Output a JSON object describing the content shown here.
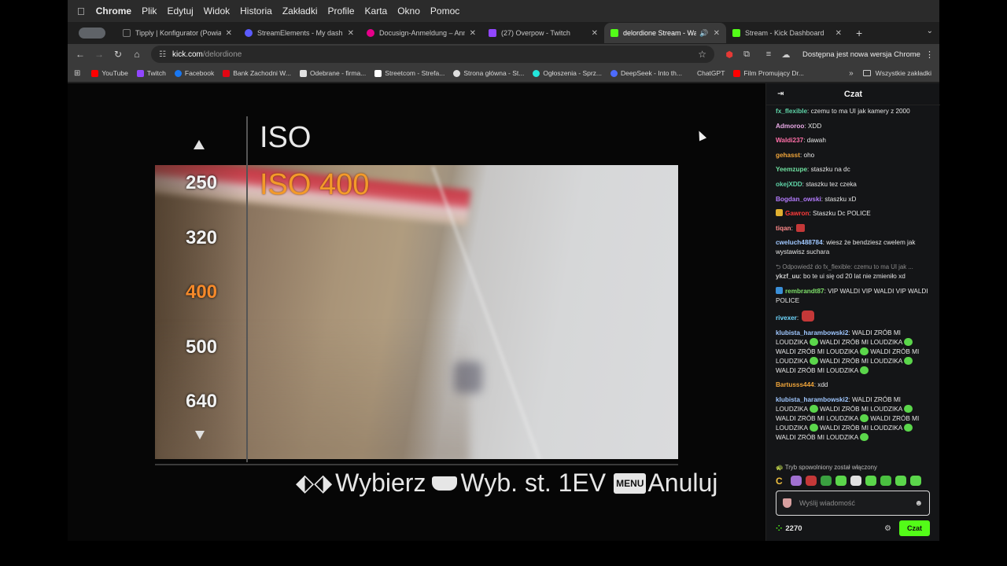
{
  "menubar": {
    "app": "Chrome",
    "items": [
      "Plik",
      "Edytuj",
      "Widok",
      "Historia",
      "Zakładki",
      "Profile",
      "Karta",
      "Okno",
      "Pomoc"
    ]
  },
  "tabs": [
    {
      "title": "Tipply | Konfigurator (Powiad",
      "color": "#222222"
    },
    {
      "title": "StreamElements - My dashb",
      "color": "#5b5bff"
    },
    {
      "title": "Docusign-Anmeldung – Anm",
      "color": "#e6008a"
    },
    {
      "title": "(27) Overpow - Twitch",
      "color": "#9146ff"
    },
    {
      "title": "delordione Stream - Watc",
      "color": "#53fc18",
      "active": true
    },
    {
      "title": "Stream - Kick Dashboard",
      "color": "#53fc18"
    }
  ],
  "toolbar": {
    "url_host": "kick.com",
    "url_path": "/delordione",
    "update_label": "Dostępna jest nowa wersja Chrome"
  },
  "bookmarks": [
    {
      "label": "YouTube",
      "color": "#ff0000"
    },
    {
      "label": "Twitch",
      "color": "#9146ff"
    },
    {
      "label": "Facebook",
      "color": "#1877f2"
    },
    {
      "label": "Bank Zachodni W...",
      "color": "#e30613"
    },
    {
      "label": "Odebrane - firma...",
      "color": "#e0e0e0"
    },
    {
      "label": "Streetcom - Strefa...",
      "color": "#ffffff"
    },
    {
      "label": "Strona główna - St...",
      "color": "#dddddd"
    },
    {
      "label": "Ogłoszenia - Sprz...",
      "color": "#23e5db"
    },
    {
      "label": "DeepSeek - Into th...",
      "color": "#4d6bfe"
    },
    {
      "label": "ChatGPT",
      "color": "#cccccc"
    },
    {
      "label": "Film Promujący Dr...",
      "color": "#ff0000"
    }
  ],
  "bookmarks_all": "Wszystkie zakładki",
  "camera": {
    "title": "ISO",
    "current": "ISO 400",
    "values": [
      "250",
      "320",
      "400",
      "500",
      "640"
    ],
    "selected_index": 2,
    "hint_select": "Wybierz",
    "hint_step": "Wyb. st. 1EV",
    "hint_menu_key": "MENU",
    "hint_cancel": "Anuluj"
  },
  "chat": {
    "title": "Czat",
    "messages": [
      {
        "user": "fx_flexible",
        "color": "#5fd4a8",
        "text": "czemu to ma UI jak kamery z 2000"
      },
      {
        "user": "Admoroo",
        "color": "#e8a9e6",
        "text": "XDD"
      },
      {
        "user": "Waldi237",
        "color": "#ff6fa8",
        "text": "dawah"
      },
      {
        "user": "gehasst",
        "color": "#f0a53a",
        "text": "oho"
      },
      {
        "user": "Yeemzupe",
        "color": "#6fe0a0",
        "text": "staszku na dc"
      },
      {
        "user": "okejXDD",
        "color": "#5fd4a8",
        "text": "staszku tez czeka"
      },
      {
        "user": "Bogdan_owski",
        "color": "#b57cff",
        "text": "staszku xD"
      },
      {
        "user": "Gawron",
        "color": "#ff3b3b",
        "text": "Staszku Dc POLICE",
        "badge": "#e0b030"
      },
      {
        "user": "tiqan",
        "color": "#ff8a8a",
        "text": "",
        "emote": "red"
      },
      {
        "user": "cweluch488784",
        "color": "#9fc7ff",
        "text": "wiesz że bendziesz cwelem jak wystawisz suchara"
      },
      {
        "reply": "Odpowiedź do fx_flexible: czemu to ma UI jak ...",
        "user": "ykzf_uu",
        "color": "#cfcfcf",
        "text": "bo te ui się od 20 lat nie zmieniło xd"
      },
      {
        "user": "rembrandt87",
        "color": "#7ee06a",
        "text": "VIP WALDI VIP WALDI VIP WALDI POLICE",
        "badge": "#3a8fd8"
      },
      {
        "user": "rivexer",
        "color": "#6fd8ff",
        "text": "",
        "emote": "big-red"
      },
      {
        "user": "klubista_harambowski2",
        "color": "#9fc7ff",
        "text": "WALDI ZRÓB MI LOUDZIKA",
        "repeat": 6
      },
      {
        "user": "Bartusss444",
        "color": "#f0a53a",
        "text": "xdd"
      },
      {
        "user": "klubista_harambowski2",
        "color": "#9fc7ff",
        "text": "WALDI ZRÓB MI LOUDZIKA",
        "repeat": 6
      }
    ],
    "slow_mode": "Tryb spowolniony został włączony",
    "input_placeholder": "Wyślij wiadomość",
    "points": "2270",
    "send_label": "Czat",
    "accent": "#53fc18"
  }
}
